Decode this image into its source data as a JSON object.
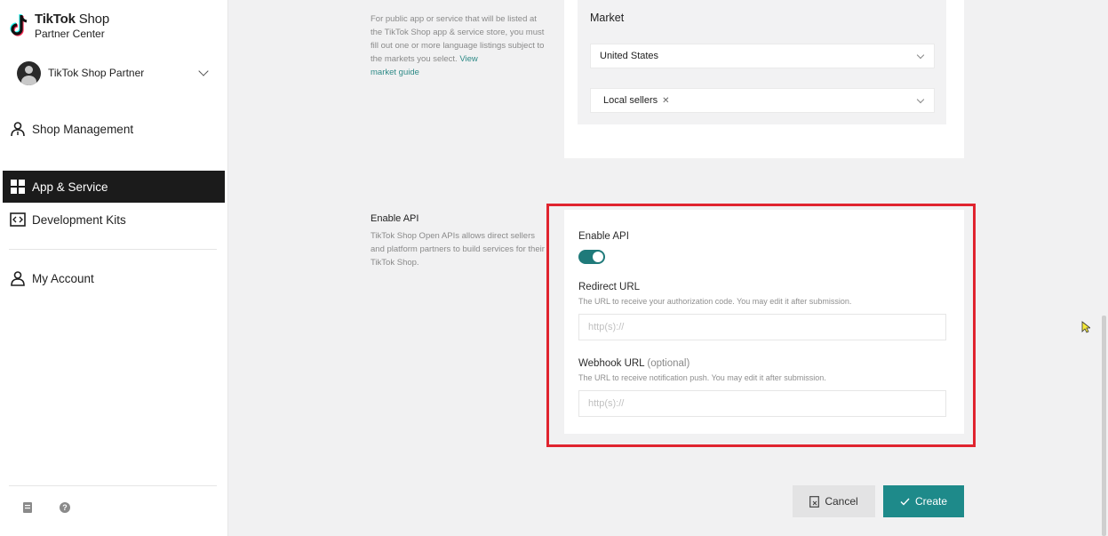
{
  "brand": {
    "name": "TikTok",
    "shop": " Shop",
    "subtitle": "Partner Center"
  },
  "account": {
    "name": "TikTok Shop Partner"
  },
  "nav": {
    "shop_management": "Shop Management",
    "app_service": "App & Service",
    "development_kits": "Development Kits",
    "my_account": "My Account"
  },
  "market_section": {
    "desc_text": "For public app or service that will be listed at the TikTok Shop app & service store, you must fill out one or more language listings subject to the markets you select. ",
    "link_view": "View",
    "link_guide": "market guide",
    "label": "Market",
    "country_value": "United States",
    "seller_tag": "Local sellers"
  },
  "api_section": {
    "title": "Enable API",
    "desc": "TikTok Shop Open APIs allows direct sellers and platform partners to build services for their TikTok Shop.",
    "enable_label": "Enable API",
    "enabled": true,
    "redirect_label": "Redirect URL",
    "redirect_help": "The URL to receive your authorization code. You may edit it after submission.",
    "redirect_placeholder": "http(s)://",
    "webhook_label": "Webhook URL",
    "webhook_optional": "(optional)",
    "webhook_help": "The URL to receive notification push. You may edit it after submission.",
    "webhook_placeholder": "http(s)://"
  },
  "actions": {
    "cancel": "Cancel",
    "create": "Create"
  },
  "colors": {
    "accent": "#1e8a8a",
    "highlight": "#e0242f",
    "active_nav": "#1b1b1b"
  }
}
